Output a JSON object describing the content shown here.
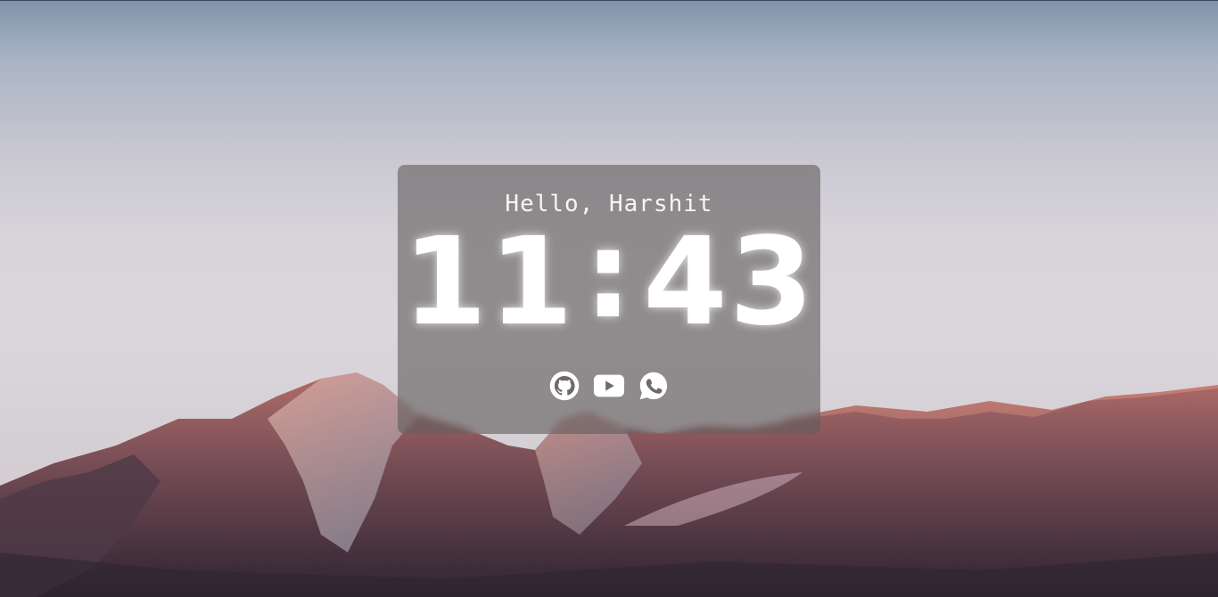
{
  "greeting": "Hello, Harshit",
  "clock": {
    "hours": "11",
    "separator": ":",
    "minutes": "43"
  },
  "socials": [
    {
      "icon": "github-icon"
    },
    {
      "icon": "youtube-icon"
    },
    {
      "icon": "whatsapp-icon"
    }
  ],
  "colors": {
    "card_background": "#625e5e",
    "text": "#ffffff",
    "sky_top": "#7f93a9",
    "sky_mid": "#d8d4da",
    "mountain_light": "#c97a6c",
    "mountain_dark": "#3f2f3a"
  }
}
